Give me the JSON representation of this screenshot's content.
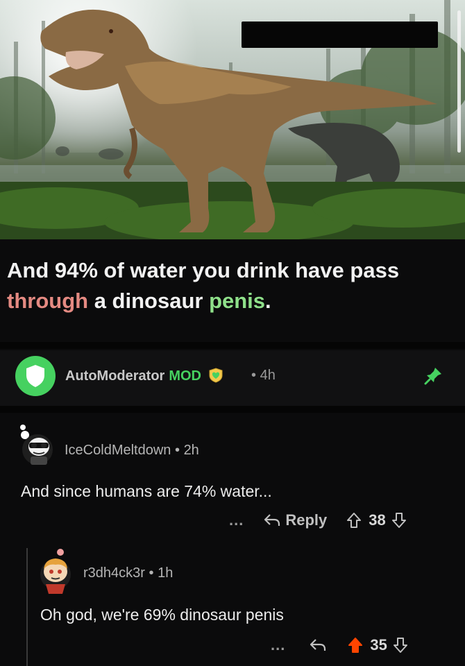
{
  "caption": {
    "line1": "And 94% of water you drink have pass",
    "through_word": "through",
    "middle": " a dinosaur ",
    "penis_word": "penis",
    "end": "."
  },
  "automod": {
    "username": "AutoModerator",
    "badge": "MOD",
    "separator": "•",
    "time": "4h",
    "icons": [
      "shield-icon",
      "heart-badge-icon",
      "pin-icon"
    ]
  },
  "comment1": {
    "username": "IceColdMeltdown",
    "separator": "•",
    "time": "2h",
    "body": "And since humans are 74% water...",
    "more": "...",
    "reply_label": "Reply",
    "votes": "38"
  },
  "comment2": {
    "username": "r3dh4ck3r",
    "separator": "•",
    "time": "1h",
    "body": "Oh god, we're 69% dinosaur penis",
    "more": "...",
    "votes": "35",
    "upvoted": true,
    "upvote_color": "#ff4500"
  },
  "colors": {
    "mod_green": "#46d160",
    "background": "#0b0b0c"
  }
}
